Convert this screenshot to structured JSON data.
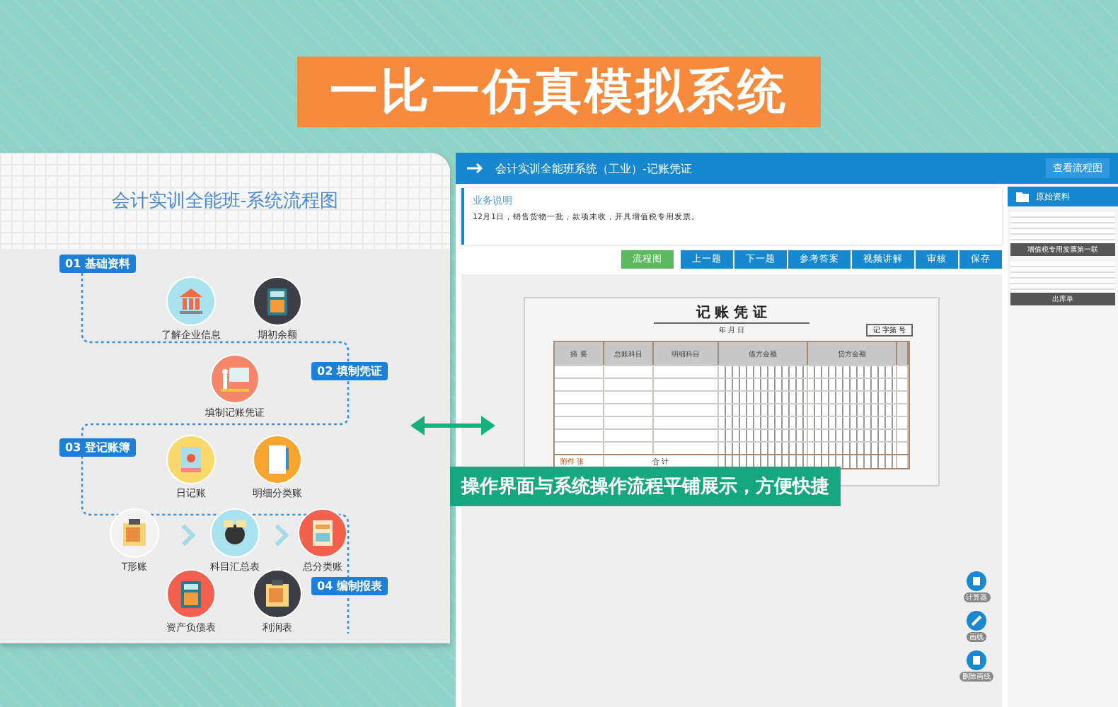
{
  "banner": {
    "title": "一比一仿真模拟系统"
  },
  "flowchart": {
    "title": "会计实训全能班-系统流程图",
    "steps": [
      {
        "label": "01  基础资料"
      },
      {
        "label": "02  填制凭证"
      },
      {
        "label": "03  登记账簿"
      },
      {
        "label": "04  编制报表"
      }
    ],
    "nodes": [
      {
        "label": "了解企业信息",
        "kind": "bank",
        "color": "#a9e3f0"
      },
      {
        "label": "期初余额",
        "kind": "calculator",
        "color": "#3c3f46"
      },
      {
        "label": "填制记账凭证",
        "kind": "teacher",
        "color": "#f4866a"
      },
      {
        "label": "日记账",
        "kind": "book",
        "color": "#f9d96b"
      },
      {
        "label": "明细分类账",
        "kind": "notebook",
        "color": "#f6a531"
      },
      {
        "label": "T形账",
        "kind": "folder",
        "color": "#f2f2f2"
      },
      {
        "label": "科目汇总表",
        "kind": "globe",
        "color": "#a9e3f0"
      },
      {
        "label": "总分类账",
        "kind": "sheet",
        "color": "#f2604e"
      },
      {
        "label": "资产负债表",
        "kind": "calculator",
        "color": "#f2604e"
      },
      {
        "label": "利润表",
        "kind": "folder",
        "color": "#3c3f46"
      }
    ]
  },
  "app": {
    "title": "会计实训全能班系统（工业）-记账凭证",
    "flow_button": "查看流程图",
    "info": {
      "heading": "业务说明",
      "text": "12月1日，销售货物一批，款项未收，开具增值税专用发票。"
    },
    "buttons": [
      {
        "label": "流程图",
        "kind": "green"
      },
      {
        "label": "上一题",
        "kind": "blue"
      },
      {
        "label": "下一题",
        "kind": "blue"
      },
      {
        "label": "参考答案",
        "kind": "blue"
      },
      {
        "label": "视频讲解",
        "kind": "blue"
      },
      {
        "label": "审核",
        "kind": "blue"
      },
      {
        "label": "保存",
        "kind": "blue"
      }
    ],
    "voucher": {
      "title": "记 账 凭 证",
      "date": "年      月      日",
      "number": "记  字第        号",
      "columns": [
        "摘    要",
        "总账科目",
        "明细科目"
      ],
      "debit": "借方金额",
      "credit": "贷方金额",
      "attachments": "附件      张",
      "total": "合      计"
    },
    "sidebar": {
      "heading": "原始资料",
      "documents": [
        "增值税专用发票第一联",
        "出库单"
      ]
    },
    "tools": [
      "计算器",
      "画线",
      "删除画线"
    ]
  },
  "callout": "操作界面与系统操作流程平铺展示，方便快捷"
}
